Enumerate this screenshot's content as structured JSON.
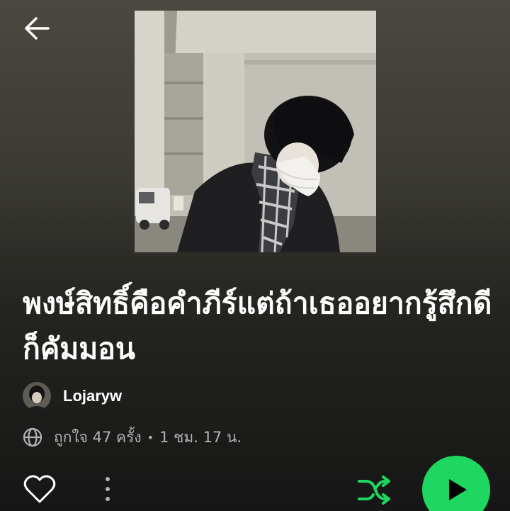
{
  "playlist": {
    "title": "พงษ์สิทธิ์คือคำภีร์แต่ถ้าเธออยากรู้สึกดีก็คัมมอน",
    "owner": "Lojaryw",
    "likes_text": "ถูกใจ 47 ครั้ง",
    "separator": "•",
    "duration": "1 ชม. 17 น."
  },
  "icons": {
    "back": "arrow-left-icon",
    "globe": "globe-icon",
    "like": "heart-outline-icon",
    "more": "more-vertical-icon",
    "shuffle": "shuffle-icon",
    "play": "play-icon"
  },
  "colors": {
    "accent": "#1ed760",
    "text_primary": "#ffffff",
    "text_secondary": "#b3b3b3"
  }
}
